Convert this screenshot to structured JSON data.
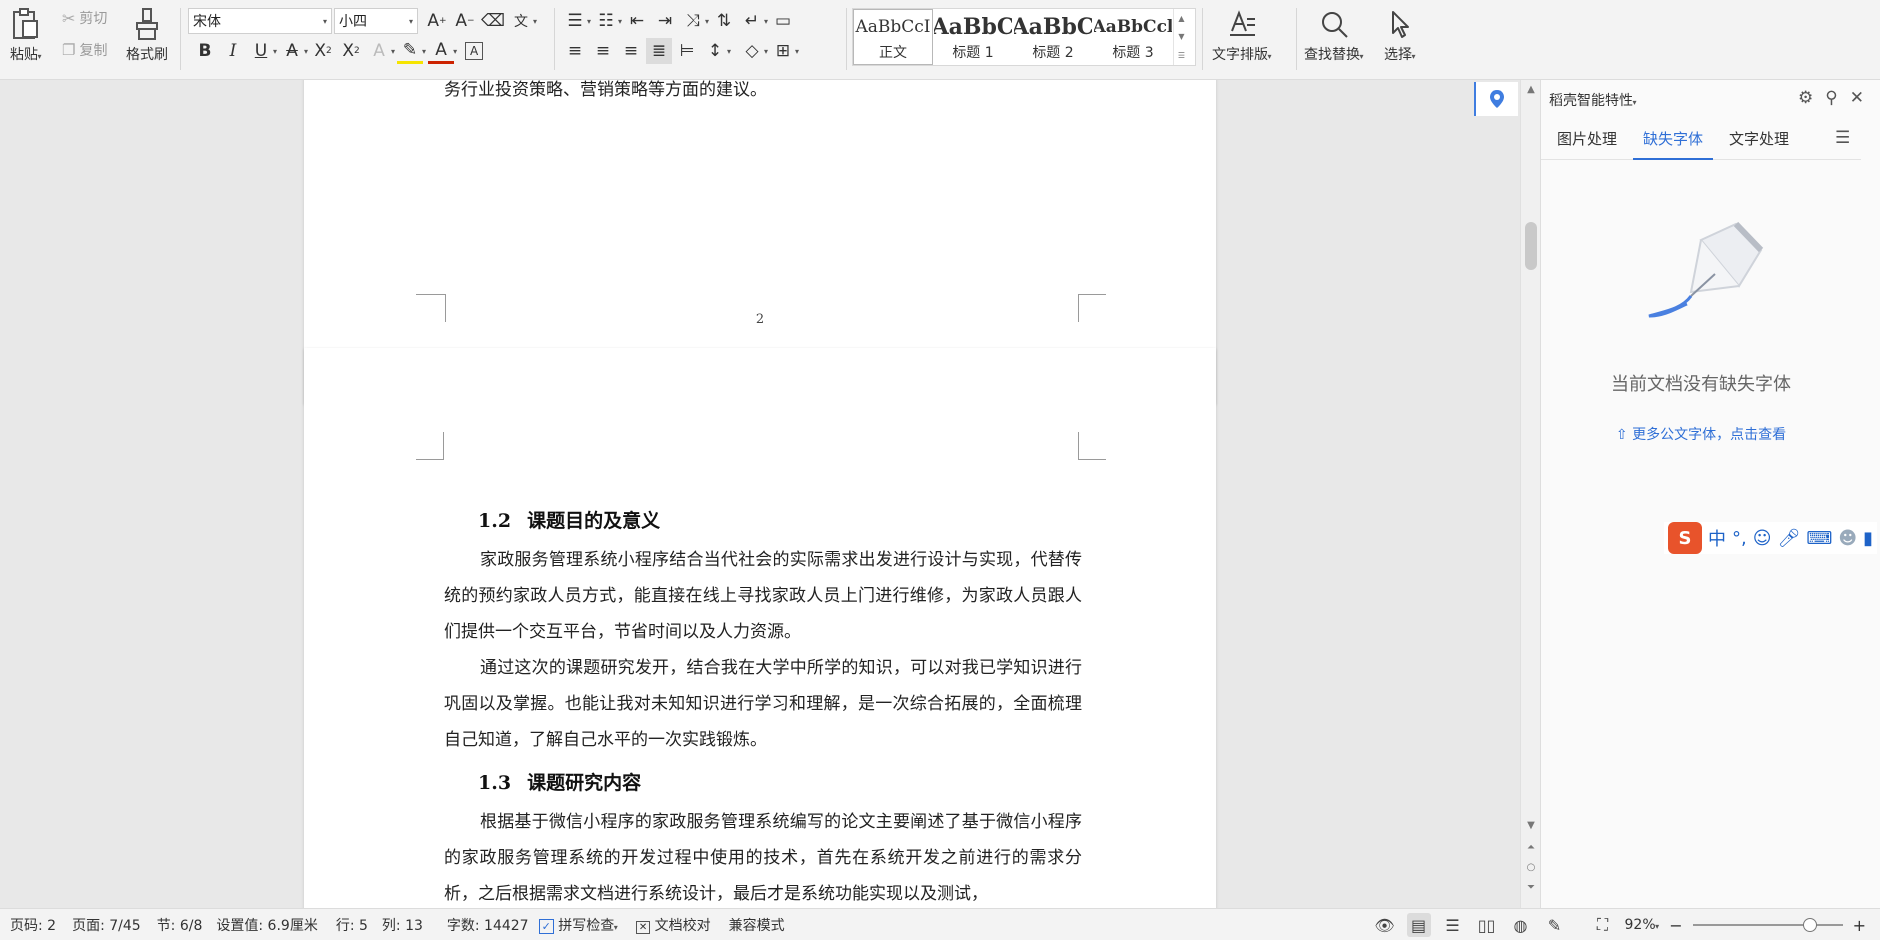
{
  "ribbon": {
    "clipboard": {
      "paste": "粘贴",
      "cut": "剪切",
      "copy": "复制",
      "format_painter": "格式刷"
    },
    "font": {
      "family": "宋体",
      "size": "小四"
    },
    "styles": [
      {
        "sample": "AaBbCcI",
        "label": "正文"
      },
      {
        "sample": "AaBbC",
        "label": "标题 1"
      },
      {
        "sample": "AaBbC",
        "label": "标题 2"
      },
      {
        "sample": "AaBbCcl",
        "label": "标题 3"
      }
    ],
    "text_layout": "文字排版",
    "find_replace": "查找替换",
    "select": "选择",
    "font_color": "#cc2200",
    "highlight_color": "#f5e400"
  },
  "document": {
    "page1_tail": "务行业投资策略、营销策略等方面的建议。",
    "page1_number": "2",
    "section_1_2": {
      "num": "1.2",
      "title": "课题目的及意义"
    },
    "para_1": "家政服务管理系统小程序结合当代社会的实际需求出发进行设计与实现，代替传统的预约家政人员方式，能直接在线上寻找家政人员上门进行维修，为家政人员跟人们提供一个交互平台，节省时间以及人力资源。",
    "para_2": "通过这次的课题研究发开，结合我在大学中所学的知识，可以对我已学知识进行巩固以及掌握。也能让我对未知知识进行学习和理解，是一次综合拓展的，全面梳理自己知道，了解自己水平的一次实践锻炼。",
    "section_1_3": {
      "num": "1.3",
      "title": "课题研究内容"
    },
    "para_3": "根据基于微信小程序的家政服务管理系统编写的论文主要阐述了基于微信小程序的家政服务管理系统的开发过程中使用的技术，首先在系统开发之前进行的需求分析，之后根据需求文档进行系统设计，最后才是系统功能实现以及测试，"
  },
  "panel": {
    "title": "稻壳智能特性",
    "tabs": [
      "图片处理",
      "缺失字体",
      "文字处理"
    ],
    "empty_message": "当前文档没有缺失字体",
    "more_link": "更多公文字体，点击查看",
    "ime": {
      "logo": "S",
      "mode": "中"
    }
  },
  "status": {
    "page_code": "页码: 2",
    "page": "页面: 7/45",
    "section": "节: 6/8",
    "setting": "设置值: 6.9厘米",
    "line": "行: 5",
    "column": "列: 13",
    "word_count": "字数: 14427",
    "spell_check": "拼写检查",
    "doc_proof": "文档校对",
    "compat_mode": "兼容模式",
    "zoom": "92%",
    "zoom_fraction": 0.78
  }
}
